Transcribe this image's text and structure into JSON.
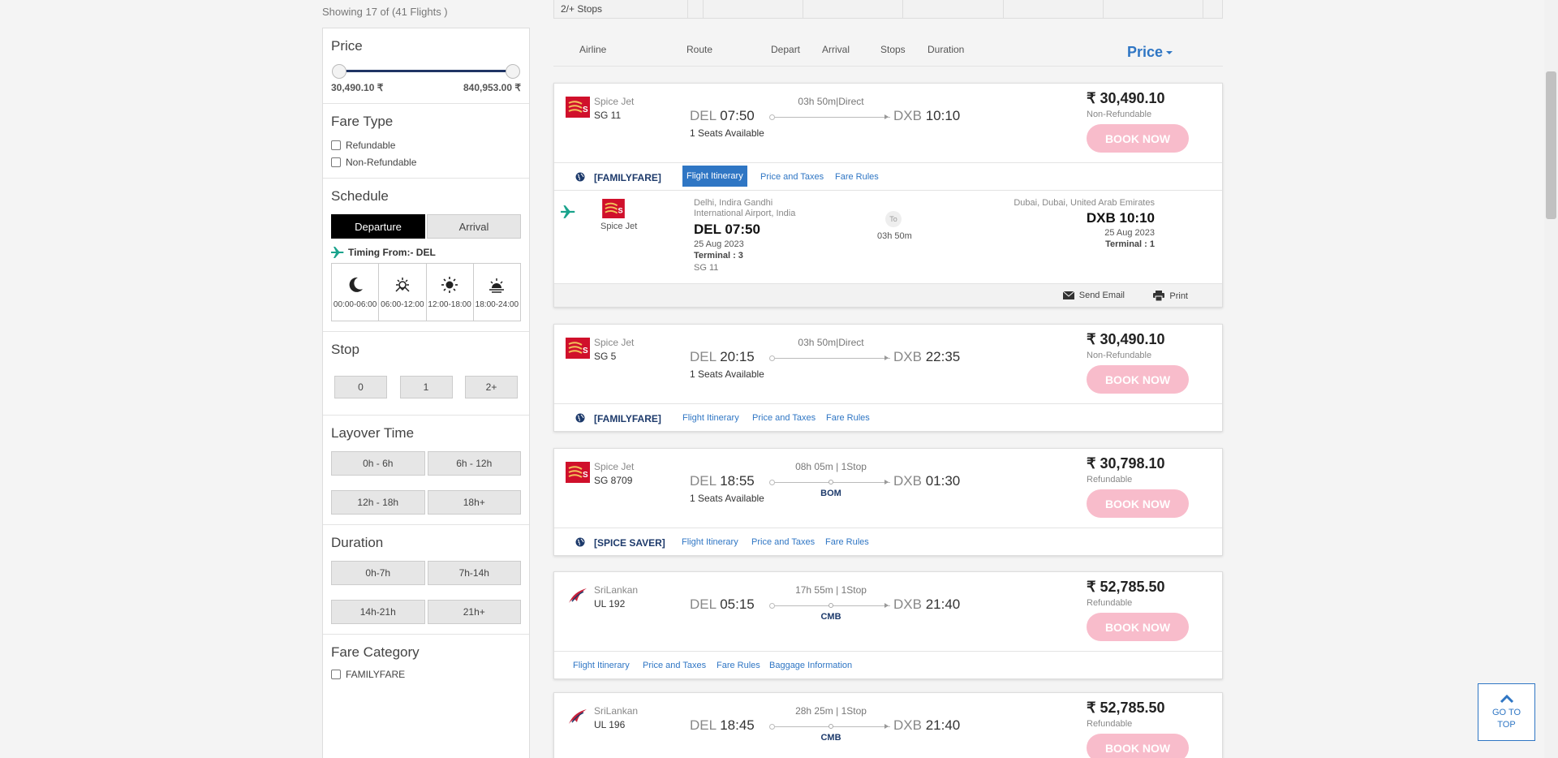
{
  "summary": {
    "showing": "Showing 17 of (41 Flights )"
  },
  "top_strip": {
    "label": "2/+ Stops"
  },
  "filters": {
    "price": {
      "title": "Price",
      "min": "30,490.10 ₹",
      "max": "840,953.00 ₹"
    },
    "fare_type": {
      "title": "Fare Type",
      "options": [
        "Refundable",
        "Non-Refundable"
      ]
    },
    "schedule": {
      "title": "Schedule",
      "tabs": [
        "Departure",
        "Arrival"
      ],
      "timing_from": "Timing From:- DEL",
      "slots": [
        "00:00-06:00",
        "06:00-12:00",
        "12:00-18:00",
        "18:00-24:00"
      ]
    },
    "stop": {
      "title": "Stop",
      "options": [
        "0",
        "1",
        "2+"
      ]
    },
    "layover": {
      "title": "Layover Time",
      "options": [
        "0h - 6h",
        "6h - 12h",
        "12h - 18h",
        "18h+"
      ]
    },
    "duration": {
      "title": "Duration",
      "options": [
        "0h-7h",
        "7h-14h",
        "14h-21h",
        "21h+"
      ]
    },
    "fare_category": {
      "title": "Fare Category",
      "options": [
        "FAMILYFARE"
      ]
    }
  },
  "sort_header": {
    "airline": "Airline",
    "route": "Route",
    "depart": "Depart",
    "arrival": "Arrival",
    "stops": "Stops",
    "duration": "Duration",
    "price": "Price"
  },
  "flights": [
    {
      "airline": "Spice Jet",
      "flight_no": "SG  11",
      "origin": "DEL",
      "dep_time": "07:50",
      "seats": "1 Seats Available",
      "duration_stops": "03h 50m|Direct",
      "via": "",
      "dest": "DXB",
      "arr_time": "10:10",
      "price": "₹ 30,490.10",
      "fare_type": "Non-Refundable",
      "book": "BOOK NOW",
      "fare_brand": "[FAMILYFARE]",
      "tabs": [
        "Flight Itinerary",
        "Price and Taxes",
        "Fare Rules"
      ],
      "itinerary": {
        "airline": "Spice Jet",
        "origin_city": "Delhi, Indira Gandhi International Airport, India",
        "origin_time": "DEL 07:50",
        "origin_date": "25 Aug 2023",
        "origin_terminal": "Terminal : 3",
        "flight_no": "SG  11",
        "to_label": "To",
        "duration": "03h 50m",
        "dest_city": "Dubai, Dubai, United Arab Emirates",
        "dest_time": "DXB 10:10",
        "dest_date": "25 Aug 2023",
        "dest_terminal": "Terminal : 1",
        "send_email": "Send Email",
        "print": "Print"
      }
    },
    {
      "airline": "Spice Jet",
      "flight_no": "SG  5",
      "origin": "DEL",
      "dep_time": "20:15",
      "seats": "1 Seats Available",
      "duration_stops": "03h 50m|Direct",
      "via": "",
      "dest": "DXB",
      "arr_time": "22:35",
      "price": "₹ 30,490.10",
      "fare_type": "Non-Refundable",
      "book": "BOOK NOW",
      "fare_brand": "[FAMILYFARE]",
      "tabs": [
        "Flight Itinerary",
        "Price and Taxes",
        "Fare Rules"
      ]
    },
    {
      "airline": "Spice Jet",
      "flight_no": "SG  8709",
      "origin": "DEL",
      "dep_time": "18:55",
      "seats": "1 Seats Available",
      "duration_stops": "08h 05m | 1Stop",
      "via": "BOM",
      "dest": "DXB",
      "arr_time": "01:30",
      "price": "₹ 30,798.10",
      "fare_type": "Refundable",
      "book": "BOOK NOW",
      "fare_brand": "[SPICE SAVER]",
      "tabs": [
        "Flight Itinerary",
        "Price and Taxes",
        "Fare Rules"
      ]
    },
    {
      "airline": "SriLankan",
      "flight_no": "UL  192",
      "origin": "DEL",
      "dep_time": "05:15",
      "seats": "",
      "duration_stops": "17h 55m | 1Stop",
      "via": "CMB",
      "dest": "DXB",
      "arr_time": "21:40",
      "price": "₹ 52,785.50",
      "fare_type": "Refundable",
      "book": "BOOK NOW",
      "fare_brand": "",
      "tabs": [
        "Flight Itinerary",
        "Price and Taxes",
        "Fare Rules",
        "Baggage Information"
      ]
    },
    {
      "airline": "SriLankan",
      "flight_no": "UL  196",
      "origin": "DEL",
      "dep_time": "18:45",
      "seats": "",
      "duration_stops": "28h 25m | 1Stop",
      "via": "CMB",
      "dest": "DXB",
      "arr_time": "21:40",
      "price": "₹ 52,785.50",
      "fare_type": "Refundable",
      "book": "BOOK NOW"
    }
  ],
  "go_to_top": {
    "line1": "GO TO",
    "line2": "TOP"
  },
  "colors": {
    "accent": "#2f76c4",
    "navy": "#1d3a6b",
    "book_button": "#f8bccb",
    "spicejet_red": "#d0102b"
  }
}
